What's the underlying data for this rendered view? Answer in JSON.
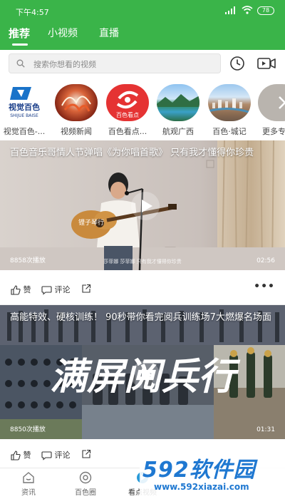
{
  "status_bar": {
    "time": "下午4:57",
    "battery": "78"
  },
  "tabs": [
    {
      "label": "推荐"
    },
    {
      "label": "小视频"
    },
    {
      "label": "直播"
    }
  ],
  "search": {
    "placeholder": "搜索你想看的视频"
  },
  "channels": [
    {
      "label": "视觉百色-...",
      "logo_text": "视觉百色",
      "logo_sub": "SHIJUE BAISE"
    },
    {
      "label": "视频新闻"
    },
    {
      "label": "百色看点...",
      "logo_text": "百色看点"
    },
    {
      "label": "航观广西"
    },
    {
      "label": "百色·城记"
    },
    {
      "label": "更多专"
    }
  ],
  "videos": [
    {
      "title": "百色音乐哥情人节弹唱《为你唱首歌》 只有我才懂得你珍贵",
      "plays": "8858次播放",
      "duration": "02:56",
      "caption": "莎菲娜 莎菲娜 只有我才懂得你珍贵",
      "guitar_text": "锂子琴行"
    },
    {
      "title": "高能特效、硬核训练！ 90秒带你看完阅兵训练场7大燃爆名场面",
      "plays": "8850次播放",
      "duration": "01:31",
      "calligraphy": "满屏阅兵行"
    }
  ],
  "actions": {
    "like": "赞",
    "comment": "评论"
  },
  "bottom_nav": [
    {
      "label": "资讯"
    },
    {
      "label": "百色圈"
    },
    {
      "label": "看点视频"
    }
  ],
  "watermark": {
    "brand": "592软件园",
    "url": "www.592xiazai.com"
  },
  "colors": {
    "brand_green": "#3ab449",
    "watermark_blue": "#1f78d1"
  }
}
